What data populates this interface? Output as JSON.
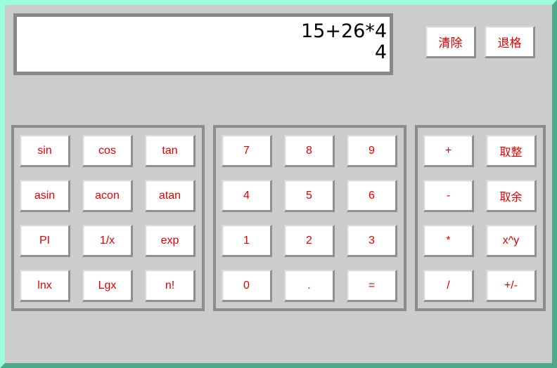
{
  "display": {
    "expression": "15+26*4",
    "current": "4"
  },
  "top_buttons": {
    "clear": "清除",
    "backspace": "退格"
  },
  "function_keys": {
    "sin": "sin",
    "cos": "cos",
    "tan": "tan",
    "asin": "asin",
    "acon": "acon",
    "atan": "atan",
    "pi": "PI",
    "reciprocal": "1/x",
    "exp": "exp",
    "lnx": "lnx",
    "lgx": "Lgx",
    "factorial": "n!"
  },
  "number_keys": {
    "n7": "7",
    "n8": "8",
    "n9": "9",
    "n4": "4",
    "n5": "5",
    "n6": "6",
    "n1": "1",
    "n2": "2",
    "n3": "3",
    "n0": "0",
    "dot": ".",
    "equals": "="
  },
  "operator_keys": {
    "plus": "+",
    "floor": "取整",
    "minus": "-",
    "mod": "取余",
    "multiply": "*",
    "power": "x^y",
    "divide": "/",
    "negate": "+/-"
  },
  "colors": {
    "window_background": "#cccccc",
    "button_text": "#e00000",
    "border_light": "#99ffdd",
    "border_dark": "#4daa89"
  }
}
